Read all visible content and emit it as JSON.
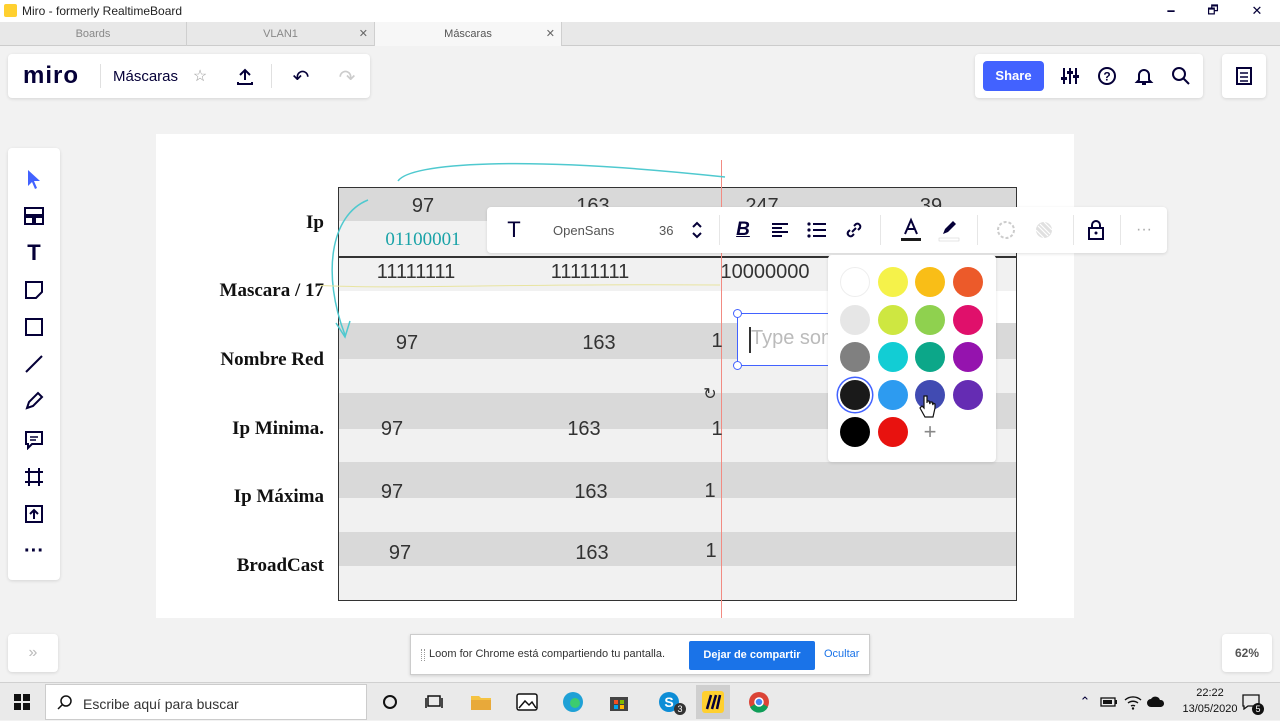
{
  "window": {
    "title": "Miro - formerly RealtimeBoard",
    "min": "🗕",
    "max": "🗗",
    "close": "✕"
  },
  "tabs": [
    {
      "label": "Boards"
    },
    {
      "label": "VLAN1"
    },
    {
      "label": "Máscaras"
    }
  ],
  "tab_close": "✕",
  "header": {
    "logo": "miro",
    "board_name": "Máscaras",
    "share_label": "Share"
  },
  "zoom": "62%",
  "table": {
    "labels": [
      "Ip",
      "Mascara / 17",
      "Nombre Red",
      "Ip Minima.",
      "Ip Máxima",
      "BroadCast"
    ],
    "ip_row": [
      "97",
      "163",
      "247",
      "39"
    ],
    "ip_binary": "01100001",
    "mask_row": [
      "11111111",
      "11111111",
      "10000000"
    ],
    "net_row": [
      "97",
      "163",
      "1"
    ],
    "min_row": [
      "97",
      "163",
      "1"
    ],
    "max_row": [
      "97",
      "163",
      "1"
    ],
    "bc_row": [
      "97",
      "163",
      "1"
    ]
  },
  "text_toolbar": {
    "font": "OpenSans",
    "size": "36",
    "text_icon": "T",
    "more": "···"
  },
  "text_input_placeholder": "Type something",
  "color_picker": {
    "colors": [
      [
        "#ffffff",
        "#f5f24a",
        "#f9be17",
        "#ec5a2a"
      ],
      [
        "#e6e6e6",
        "#cee741",
        "#8fd14f",
        "#e0106b"
      ],
      [
        "#808080",
        "#12cdd4",
        "#0ca789",
        "#9513ae"
      ],
      [
        "#1a1a1a",
        "#2d9bf0",
        "#414bb2",
        "#652cb3"
      ],
      [
        "#000000",
        "#e8120f"
      ]
    ],
    "add": "+"
  },
  "notification": {
    "text": "Loom for Chrome está compartiendo tu pantalla.",
    "stop_label": "Dejar de compartir",
    "hide_label": "Ocultar"
  },
  "collapse": "»",
  "taskbar": {
    "search_placeholder": "Escribe aquí para buscar",
    "time": "22:22",
    "date": "13/05/2020",
    "notif_count": "5",
    "badge_s": "3"
  },
  "accent": "#4262ff"
}
